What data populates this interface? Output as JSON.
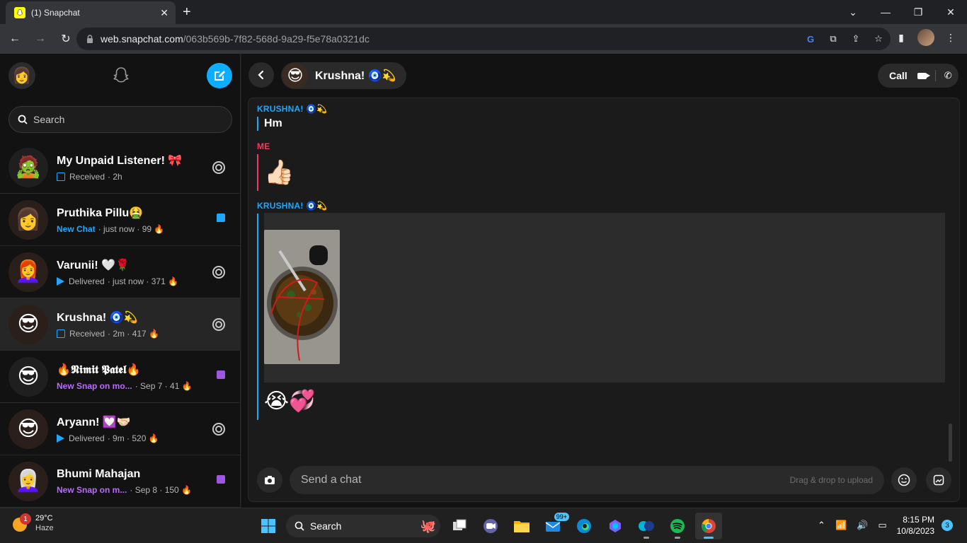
{
  "browser": {
    "tab_title": "(1) Snapchat",
    "url_host": "web.snapchat.com",
    "url_path": "/063b569b-7f82-568d-9a29-f5e78a0321dc"
  },
  "sidebar": {
    "search_placeholder": "Search",
    "chats": [
      {
        "name": "My Unpaid Listener! 🎀",
        "status": "Received",
        "meta": " · 2h",
        "status_type": "received",
        "action": "camera",
        "avatar": "🧟",
        "avatar_bg": "#1f1f1f",
        "badge": "📌"
      },
      {
        "name": "Pruthika Pillu🤮",
        "status": "New Chat",
        "meta": " · just now · 99 🔥",
        "status_type": "new-chat",
        "action": "chat",
        "avatar": "👩",
        "avatar_bg": "#2a1f1a"
      },
      {
        "name": "Varunii! 🤍🌹",
        "status": "Delivered",
        "meta": " · just now · 371 🔥",
        "status_type": "delivered",
        "action": "camera",
        "avatar": "👩‍🦰",
        "avatar_bg": "#2a1f1a",
        "badge": "😊"
      },
      {
        "name": "Krushna! 🧿💫",
        "status": "Received",
        "meta": " · 2m · 417 🔥",
        "status_type": "received",
        "action": "camera",
        "avatar": "😎",
        "avatar_bg": "#2a1f1a",
        "badge": "😊"
      },
      {
        "name": "🔥𝕹𝖎𝖒𝖎𝖙 𝕻𝖆𝖙𝖊𝖑🔥",
        "status": "New Snap on mo...",
        "meta": " · Sep 7 · 41 🔥",
        "status_type": "new-snap",
        "action": "snap",
        "avatar": "😎",
        "avatar_bg": "#1f1f1f"
      },
      {
        "name": "Aryann! 💟🤝🏻",
        "status": "Delivered",
        "meta": " · 9m · 520 🔥",
        "status_type": "delivered",
        "action": "camera",
        "avatar": "😎",
        "avatar_bg": "#2a1f1a",
        "badge": "😊"
      },
      {
        "name": "Bhumi Mahajan",
        "status": "New Snap on m...",
        "meta": " · Sep 8 · 150 🔥",
        "status_type": "new-snap",
        "action": "snap",
        "avatar": "👩‍🦳",
        "avatar_bg": "#2a1f1a"
      }
    ]
  },
  "chat": {
    "contact_name": "Krushna! 🧿💫",
    "call_label": "Call",
    "messages": [
      {
        "sender": "KRUSHNA! 🧿💫",
        "text": "Hm"
      },
      {
        "sender": "ME",
        "text": "👍🏻"
      },
      {
        "sender": "KRUSHNA! 🧿💫",
        "text": "😭💞"
      }
    ],
    "composer_placeholder": "Send a chat",
    "drag_drop_label": "Drag & drop to upload"
  },
  "taskbar": {
    "temperature": "29°C",
    "condition": "Haze",
    "weather_badge": "1",
    "search_label": "Search",
    "mail_badge": "99+",
    "time": "8:15 PM",
    "date": "10/8/2023",
    "notification_count": "3"
  },
  "colors": {
    "accent_blue": "#0fadff",
    "me_red": "#f23c57",
    "snap_purple": "#9b57e0"
  }
}
